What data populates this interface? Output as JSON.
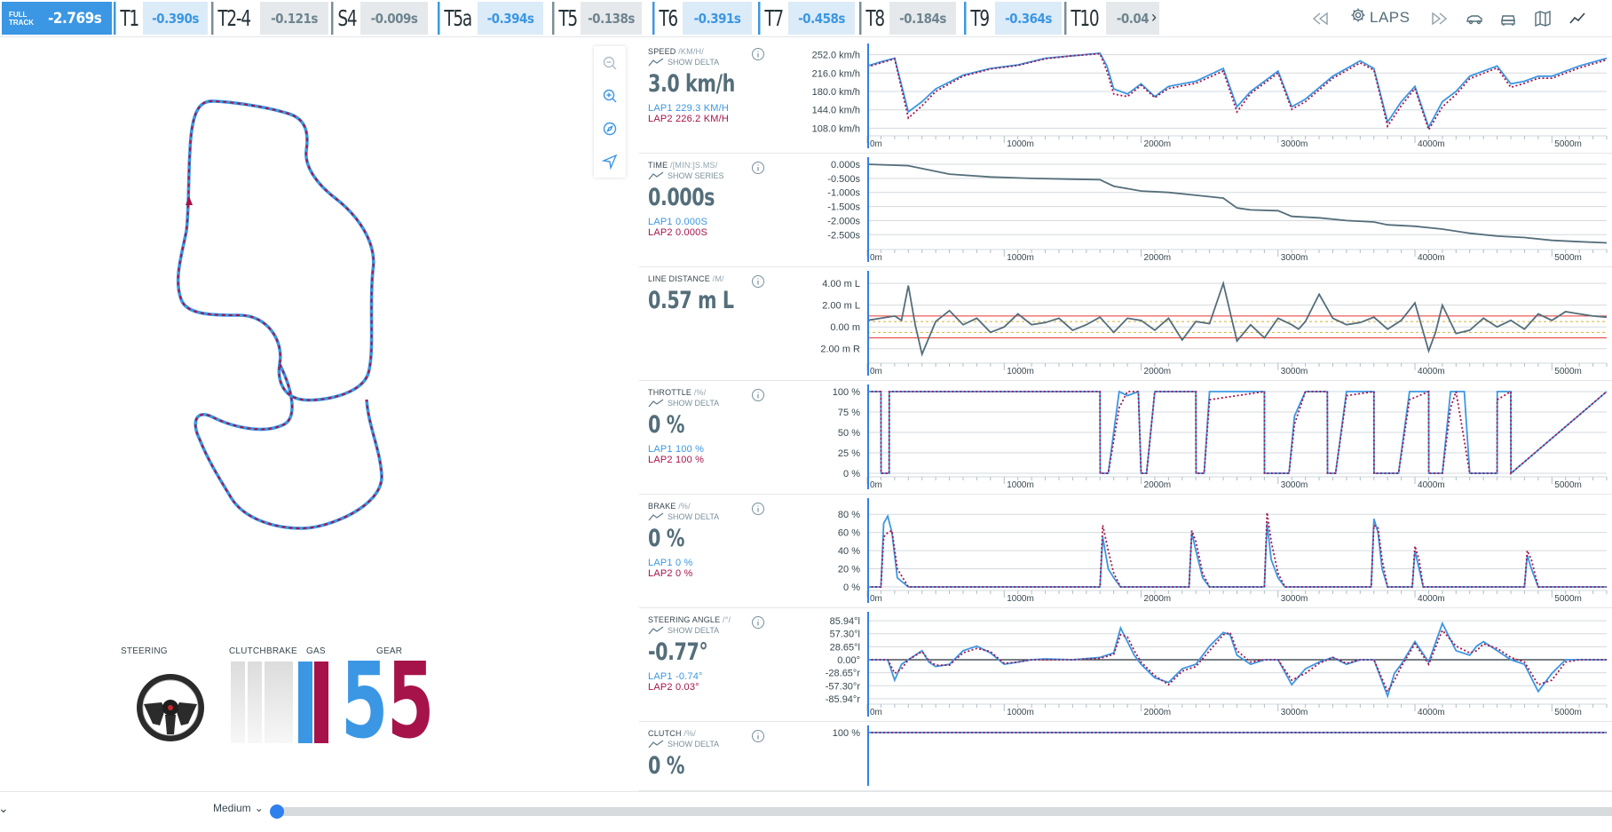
{
  "sectors": {
    "full_track": {
      "label": "FULL TRACK",
      "delta": "-2.769s"
    },
    "items": [
      {
        "name": "T1",
        "delta": "-0.390s",
        "tone": "blue"
      },
      {
        "name": "T2-4",
        "delta": "-0.121s",
        "tone": "grey"
      },
      {
        "name": "S4",
        "delta": "-0.009s",
        "tone": "grey"
      },
      {
        "name": "T5a",
        "delta": "-0.394s",
        "tone": "blue"
      },
      {
        "name": "T5",
        "delta": "-0.138s",
        "tone": "grey"
      },
      {
        "name": "T6",
        "delta": "-0.391s",
        "tone": "blue"
      },
      {
        "name": "T7",
        "delta": "-0.458s",
        "tone": "blue"
      },
      {
        "name": "T8",
        "delta": "-0.184s",
        "tone": "grey"
      },
      {
        "name": "T9",
        "delta": "-0.364s",
        "tone": "blue"
      },
      {
        "name": "T10",
        "delta": "-0.04",
        "tone": "grey"
      }
    ]
  },
  "toolbar": {
    "laps_label": "LAPS",
    "icons": [
      "skip-back-icon",
      "gear-icon",
      "skip-forward-icon",
      "car-side-icon",
      "car-front-icon",
      "map-icon",
      "chart-line-icon"
    ]
  },
  "map_tools": [
    "zoom-out-icon",
    "zoom-in-icon",
    "compass-icon",
    "navigate-icon"
  ],
  "inputs": {
    "steering_label": "STEERING",
    "clutch_label": "CLUTCH",
    "brake_label": "BRAKE",
    "gas_label": "GAS",
    "gear_label": "GEAR",
    "gear_lap1": "5",
    "gear_lap2": "5",
    "lap1_gas": 1.0,
    "lap2_gas": 1.0
  },
  "colors": {
    "lap1": "#3b97e3",
    "lap2": "#a6134a",
    "delta": "#546e7a",
    "band_red": "#e53935",
    "band_yellow": "#d4b13c"
  },
  "distance_ticks": [
    "0m",
    "1000m",
    "2000m",
    "3000m",
    "4000m",
    "5000m"
  ],
  "channels": {
    "speed": {
      "name": "SPEED",
      "unit": "/KM/H/",
      "toggle": "SHOW DELTA",
      "value": "3.0 km/h",
      "lap1": "LAP1 229.3 KM/H",
      "lap2": "LAP2 226.2 KM/H"
    },
    "time": {
      "name": "TIME",
      "unit": "/[MIN:]S.MS/",
      "toggle": "SHOW SERIES",
      "value": "0.000s",
      "lap1": "LAP1 0.000S",
      "lap2": "LAP2 0.000S"
    },
    "line": {
      "name": "LINE DISTANCE",
      "unit": "/M/",
      "value": "0.57 m L"
    },
    "throttle": {
      "name": "THROTTLE",
      "unit": "/%/",
      "toggle": "SHOW DELTA",
      "value": "0 %",
      "lap1": "LAP1 100 %",
      "lap2": "LAP2 100 %"
    },
    "brake": {
      "name": "BRAKE",
      "unit": "/%/",
      "toggle": "SHOW DELTA",
      "value": "0 %",
      "lap1": "LAP1 0 %",
      "lap2": "LAP2 0 %"
    },
    "steering": {
      "name": "STEERING ANGLE",
      "unit": "/°/",
      "toggle": "SHOW DELTA",
      "value": "-0.77°",
      "lap1": "LAP1 -0.74°",
      "lap2": "LAP2 0.03°"
    },
    "clutch": {
      "name": "CLUTCH",
      "unit": "/%/",
      "toggle": "SHOW DELTA",
      "value": "0 %"
    }
  },
  "chart_data": [
    {
      "type": "line",
      "title": "SPEED",
      "ylabel": "km/h",
      "x_label_unit": "m",
      "xlim": [
        0,
        5400
      ],
      "yticks": [
        "252.0 km/h",
        "216.0 km/h",
        "180.0 km/h",
        "144.0 km/h",
        "108.0 km/h"
      ],
      "ylim": [
        100,
        260
      ],
      "x": [
        0,
        100,
        200,
        300,
        400,
        500,
        700,
        900,
        1100,
        1300,
        1500,
        1700,
        1750,
        1800,
        1900,
        2000,
        2100,
        2200,
        2400,
        2600,
        2700,
        2750,
        2800,
        3000,
        3100,
        3200,
        3400,
        3600,
        3700,
        3800,
        3900,
        4000,
        4100,
        4200,
        4300,
        4400,
        4600,
        4700,
        4800,
        4900,
        5000,
        5200,
        5400
      ],
      "series": [
        {
          "name": "LAP1",
          "values": [
            230,
            238,
            245,
            140,
            160,
            185,
            212,
            225,
            232,
            245,
            250,
            255,
            230,
            185,
            175,
            195,
            170,
            190,
            200,
            225,
            150,
            165,
            180,
            220,
            150,
            165,
            210,
            240,
            225,
            120,
            160,
            190,
            110,
            160,
            180,
            210,
            230,
            195,
            200,
            210,
            210,
            230,
            245
          ]
        },
        {
          "name": "LAP2",
          "values": [
            228,
            236,
            244,
            128,
            152,
            180,
            210,
            224,
            231,
            244,
            250,
            254,
            220,
            175,
            170,
            192,
            168,
            186,
            196,
            220,
            140,
            158,
            176,
            216,
            145,
            160,
            206,
            236,
            222,
            112,
            152,
            186,
            105,
            150,
            174,
            205,
            226,
            188,
            196,
            206,
            206,
            226,
            242
          ]
        }
      ]
    },
    {
      "type": "line",
      "title": "TIME",
      "ylabel": "s",
      "xlim": [
        0,
        5400
      ],
      "yticks": [
        "-2.500s",
        "-2.000s",
        "-1.500s",
        "-1.000s",
        "-0.500s",
        "0.000s"
      ],
      "ylim": [
        -2.9,
        0
      ],
      "x": [
        0,
        300,
        600,
        900,
        1200,
        1500,
        1700,
        1800,
        2000,
        2200,
        2400,
        2600,
        2700,
        2800,
        3000,
        3100,
        3300,
        3500,
        3700,
        3800,
        4000,
        4200,
        4400,
        4600,
        4800,
        5000,
        5200,
        5400
      ],
      "series": [
        {
          "name": "DELTA",
          "values": [
            0,
            -0.05,
            -0.35,
            -0.45,
            -0.5,
            -0.53,
            -0.55,
            -0.78,
            -0.95,
            -1.0,
            -1.1,
            -1.2,
            -1.55,
            -1.62,
            -1.65,
            -1.85,
            -1.9,
            -2.0,
            -2.05,
            -2.15,
            -2.2,
            -2.3,
            -2.45,
            -2.55,
            -2.6,
            -2.7,
            -2.75,
            -2.79
          ]
        }
      ]
    },
    {
      "type": "line",
      "title": "LINE DISTANCE",
      "ylabel": "m",
      "xlim": [
        0,
        5400
      ],
      "yticks": [
        "4.00 m L",
        "2.00 m L",
        "0.00 m",
        "2.00 m R"
      ],
      "ylim": [
        -3,
        4.5
      ],
      "x": [
        0,
        100,
        200,
        250,
        300,
        350,
        400,
        450,
        500,
        600,
        700,
        800,
        900,
        1000,
        1100,
        1200,
        1300,
        1400,
        1500,
        1600,
        1700,
        1800,
        1900,
        2000,
        2100,
        2200,
        2300,
        2400,
        2500,
        2600,
        2700,
        2800,
        2900,
        3000,
        3100,
        3150,
        3200,
        3300,
        3400,
        3500,
        3600,
        3700,
        3800,
        3900,
        4000,
        4100,
        4150,
        4200,
        4300,
        4400,
        4500,
        4600,
        4700,
        4800,
        4900,
        5000,
        5100,
        5200,
        5300,
        5400
      ],
      "series": [
        {
          "name": "LINE",
          "values": [
            0.6,
            0.8,
            1.0,
            0.6,
            3.8,
            0.2,
            -2.5,
            -1.0,
            0.5,
            1.5,
            0.2,
            0.8,
            -0.5,
            0.0,
            1.2,
            0.2,
            0.4,
            0.8,
            -0.3,
            0.2,
            0.9,
            -0.5,
            0.8,
            0.6,
            -0.3,
            0.8,
            -1.2,
            0.5,
            0.3,
            4.0,
            -1.3,
            0.2,
            -1.0,
            0.8,
            0.2,
            -0.2,
            0.5,
            3.0,
            0.8,
            0.2,
            0.4,
            0.9,
            -0.2,
            0.6,
            2.2,
            -2.2,
            -0.5,
            2.0,
            -0.6,
            -0.3,
            0.8,
            0.0,
            0.6,
            -0.2,
            1.2,
            0.6,
            1.4,
            1.2,
            1.0,
            0.9
          ]
        }
      ]
    },
    {
      "type": "line",
      "title": "THROTTLE",
      "ylabel": "%",
      "xlim": [
        0,
        5400
      ],
      "yticks": [
        "100 %",
        "75 %",
        "50 %",
        "25 %",
        "0 %"
      ],
      "ylim": [
        0,
        100
      ],
      "x": [
        0,
        100,
        101,
        160,
        161,
        170,
        1700,
        1701,
        1760,
        1840,
        1900,
        1980,
        2000,
        2040,
        2100,
        2400,
        2401,
        2460,
        2500,
        2900,
        2901,
        3080,
        3120,
        3200,
        3360,
        3361,
        3420,
        3500,
        3700,
        3701,
        3880,
        3960,
        4100,
        4101,
        4200,
        4260,
        4300,
        4360,
        4400,
        4600,
        4601,
        4700,
        4701,
        5400
      ],
      "series": [
        {
          "name": "LAP1",
          "values": [
            100,
            100,
            0,
            0,
            100,
            100,
            100,
            0,
            0,
            100,
            95,
            100,
            0,
            0,
            100,
            100,
            0,
            0,
            100,
            100,
            0,
            0,
            70,
            100,
            100,
            0,
            0,
            100,
            100,
            0,
            0,
            100,
            100,
            0,
            0,
            100,
            100,
            100,
            0,
            0,
            100,
            100,
            0,
            100
          ]
        },
        {
          "name": "LAP2",
          "values": [
            100,
            100,
            0,
            0,
            100,
            100,
            100,
            0,
            0,
            80,
            100,
            100,
            0,
            0,
            100,
            100,
            0,
            0,
            90,
            100,
            0,
            0,
            60,
            100,
            100,
            0,
            0,
            95,
            100,
            0,
            0,
            90,
            100,
            0,
            0,
            80,
            100,
            40,
            0,
            0,
            90,
            100,
            0,
            100
          ]
        }
      ]
    },
    {
      "type": "line",
      "title": "BRAKE",
      "ylabel": "%",
      "xlim": [
        0,
        5400
      ],
      "yticks": [
        "80 %",
        "60 %",
        "40 %",
        "20 %",
        "0 %"
      ],
      "ylim": [
        0,
        90
      ],
      "x": [
        0,
        100,
        120,
        150,
        180,
        220,
        300,
        1700,
        1720,
        1760,
        1800,
        1850,
        2000,
        2350,
        2370,
        2400,
        2450,
        2500,
        2900,
        2920,
        2950,
        3000,
        3050,
        3680,
        3700,
        3730,
        3760,
        3800,
        3980,
        4000,
        4030,
        4060,
        4800,
        4820,
        4850,
        4900,
        5400
      ],
      "series": [
        {
          "name": "LAP1",
          "values": [
            0,
            0,
            70,
            78,
            60,
            10,
            0,
            0,
            55,
            20,
            10,
            0,
            0,
            0,
            60,
            40,
            10,
            0,
            0,
            70,
            30,
            10,
            0,
            0,
            75,
            60,
            20,
            0,
            0,
            40,
            20,
            0,
            0,
            35,
            20,
            0,
            0
          ]
        },
        {
          "name": "LAP2",
          "values": [
            0,
            0,
            55,
            60,
            62,
            20,
            0,
            0,
            68,
            40,
            15,
            0,
            0,
            0,
            62,
            50,
            15,
            0,
            0,
            82,
            50,
            15,
            0,
            0,
            68,
            65,
            30,
            0,
            0,
            45,
            30,
            0,
            0,
            40,
            30,
            0,
            0
          ]
        }
      ]
    },
    {
      "type": "line",
      "title": "STEERING ANGLE",
      "ylabel": "°",
      "xlim": [
        0,
        5400
      ],
      "yticks": [
        "85.94°l",
        "57.30°l",
        "28.65°l",
        "0.00°",
        "-28.65°r",
        "-57.30°r",
        "-85.94°r"
      ],
      "ylim": [
        -90,
        90
      ],
      "x": [
        0,
        150,
        200,
        250,
        300,
        400,
        450,
        500,
        600,
        700,
        800,
        900,
        1000,
        1100,
        1200,
        1300,
        1500,
        1700,
        1800,
        1850,
        1900,
        1950,
        2000,
        2100,
        2200,
        2300,
        2400,
        2500,
        2600,
        2650,
        2700,
        2800,
        2900,
        3000,
        3100,
        3200,
        3300,
        3400,
        3500,
        3600,
        3700,
        3800,
        3850,
        3900,
        3950,
        4000,
        4100,
        4200,
        4300,
        4400,
        4450,
        4500,
        4600,
        4700,
        4800,
        4900,
        5000,
        5100,
        5200,
        5400
      ],
      "series": [
        {
          "name": "LAP1",
          "values": [
            0,
            0,
            -45,
            -10,
            0,
            20,
            -5,
            -15,
            -10,
            20,
            30,
            15,
            -10,
            -5,
            0,
            2,
            0,
            5,
            15,
            70,
            40,
            10,
            -10,
            -40,
            -50,
            -20,
            -10,
            30,
            60,
            55,
            10,
            -10,
            0,
            0,
            -55,
            -20,
            -5,
            5,
            -10,
            0,
            0,
            -80,
            -30,
            -10,
            15,
            40,
            -5,
            80,
            20,
            10,
            30,
            40,
            20,
            0,
            -10,
            -70,
            -30,
            0,
            0,
            0
          ]
        },
        {
          "name": "LAP2",
          "values": [
            0,
            0,
            -30,
            -20,
            0,
            18,
            -2,
            -12,
            -12,
            15,
            25,
            18,
            -8,
            -5,
            0,
            0,
            0,
            3,
            12,
            55,
            50,
            20,
            -5,
            -35,
            -55,
            -25,
            -15,
            20,
            55,
            60,
            20,
            -5,
            0,
            0,
            -45,
            -30,
            -8,
            5,
            -8,
            0,
            0,
            -70,
            -45,
            -15,
            10,
            35,
            -10,
            65,
            30,
            15,
            20,
            35,
            25,
            5,
            -5,
            -55,
            -45,
            -5,
            0,
            0
          ]
        }
      ]
    },
    {
      "type": "line",
      "title": "CLUTCH",
      "ylabel": "%",
      "xlim": [
        0,
        5400
      ],
      "yticks": [
        "100 %"
      ],
      "ylim": [
        0,
        100
      ],
      "x": [
        0,
        5400
      ],
      "series": [
        {
          "name": "LAP1",
          "values": [
            100,
            100
          ]
        },
        {
          "name": "LAP2",
          "values": [
            100,
            100
          ]
        }
      ]
    }
  ],
  "footer": {
    "playback_speed": "Medium",
    "progress": 0.0
  }
}
